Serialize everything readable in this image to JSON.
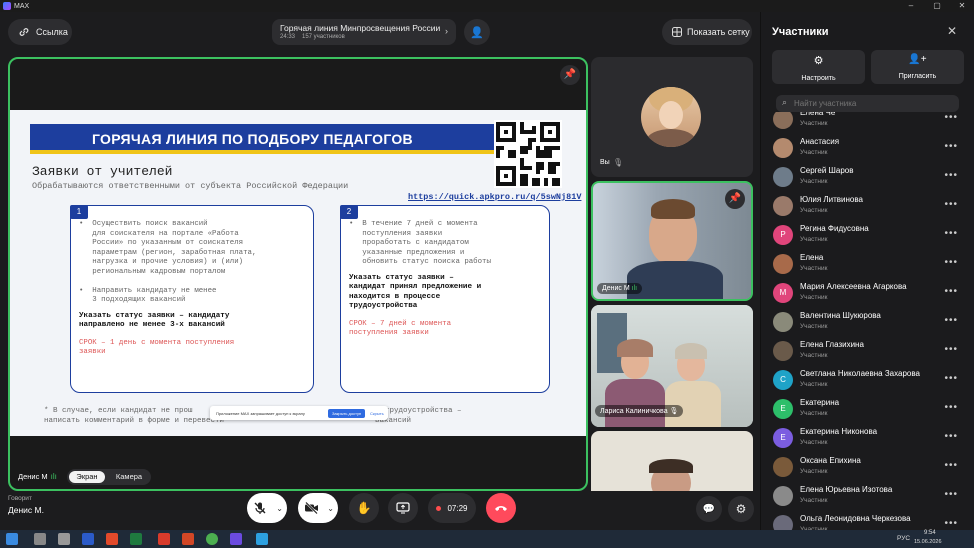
{
  "titlebar": {
    "app": "MAX"
  },
  "header": {
    "link_label": "Ссылка",
    "meeting_title": "Горячая линия Минпросвещения России",
    "meeting_time": "24:33",
    "participant_count": "157 участников",
    "grid_label": "Показать сетку"
  },
  "slide": {
    "banner": "ГОРЯЧАЯ ЛИНИЯ ПО ПОДБОРУ ПЕДАГОГОВ",
    "heading": "Заявки от учителей",
    "subheading": "Обрабатываются ответственными от субъекта Российской Федерации",
    "url": "https://quick.apkpro.ru/q/5swNj81V",
    "box1": {
      "num": "1",
      "lines": [
        "•  Осуществить поиск вакансий",
        "   для соискателя на портале «Работа",
        "   России» по указанным от соискателя",
        "   параметрам (регион, заработная плата,",
        "   нагрузка и прочие условия) и (или)",
        "   региональным кадровым порталом",
        "",
        "•  Направить кандидату не менее",
        "   3 подходящих вакансий"
      ],
      "bold": [
        "Указать статус заявки – кандидату",
        "направлено не менее 3-х вакансий"
      ],
      "red": [
        "СРОК – 1 день с момента поступления",
        "заявки"
      ]
    },
    "box2": {
      "num": "2",
      "lines": [
        "•  В течение 7 дней с момента",
        "   поступления заявки",
        "   проработать с кандидатом",
        "   указанные предложения и",
        "   обновить статус поиска работы"
      ],
      "bold": [
        "Указать статус заявки –",
        "кандидат принял предложение и",
        "находится в процессе",
        "трудоустройства"
      ],
      "red": [
        "СРОК – 7 дней с момента",
        "поступления заявки"
      ]
    },
    "footnote1": "* В случае, если кандидат не прош",
    "footnote1b": "трудоустройства –",
    "footnote2": "написать комментарий в форме и перевести",
    "footnote2b": "вакансий",
    "share_notice": "Приложение MAX запрашивает доступ к экрану",
    "share_open": "Закрыть доступ",
    "share_hide": "Скрыть"
  },
  "stage": {
    "speaker_tag": "Денис М",
    "tab_screen": "Экран",
    "tab_camera": "Камера"
  },
  "tiles": {
    "you_label": "Вы",
    "denis_label": "Денис М",
    "larisa_label": "Лариса Калиничкова"
  },
  "footer": {
    "speaking_label": "Говорит",
    "speaking_name": "Денис М.",
    "timer": "07:29"
  },
  "panel": {
    "title": "Участники",
    "setup_label": "Настроить",
    "invite_label": "Пригласить",
    "search_placeholder": "Найти участника"
  },
  "participants": [
    {
      "name": "Елена Че",
      "role": "Участник",
      "initial": "",
      "color": "#8a6e5a"
    },
    {
      "name": "Анастасия",
      "role": "Участник",
      "initial": "",
      "color": "#b48a6e"
    },
    {
      "name": "Сергей Шаров",
      "role": "Участник",
      "initial": "",
      "color": "#6e7c8a"
    },
    {
      "name": "Юлия Литвинова",
      "role": "Участник",
      "initial": "",
      "color": "#9a7a6a"
    },
    {
      "name": "Регина Фидусовна",
      "role": "Участник",
      "initial": "Р",
      "color": "#e0457b"
    },
    {
      "name": "Елена",
      "role": "Участник",
      "initial": "",
      "color": "#a86a4a"
    },
    {
      "name": "Мария Алексеевна Агаркова",
      "role": "Участник",
      "initial": "М",
      "color": "#e0457b"
    },
    {
      "name": "Валентина Шукюрова",
      "role": "Участник",
      "initial": "",
      "color": "#8a8a7a"
    },
    {
      "name": "Елена Глазихина",
      "role": "Участник",
      "initial": "",
      "color": "#6a5a4a"
    },
    {
      "name": "Светлана Николаевна Захарова",
      "role": "Участник",
      "initial": "С",
      "color": "#1fa3c8"
    },
    {
      "name": "Екатерина",
      "role": "Участник",
      "initial": "Е",
      "color": "#2dbf6a"
    },
    {
      "name": "Екатерина Никонова",
      "role": "Участник",
      "initial": "Е",
      "color": "#7b5de0"
    },
    {
      "name": "Оксана Епихина",
      "role": "Участник",
      "initial": "",
      "color": "#7a5a3a"
    },
    {
      "name": "Елена Юрьевна Изотова",
      "role": "Участник",
      "initial": "",
      "color": "#8a8a8a"
    },
    {
      "name": "Ольга Леонидовна Черкезова",
      "role": "Участник",
      "initial": "",
      "color": "#6a6a7a"
    }
  ],
  "taskbar": {
    "time": "9:54",
    "date": "15.06.2026",
    "lang": "РУС"
  }
}
